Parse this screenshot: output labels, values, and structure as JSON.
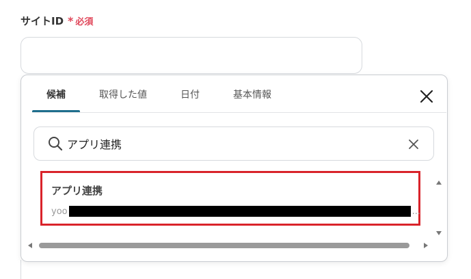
{
  "field": {
    "label": "サイトID",
    "required_star": "*",
    "required_text": "必須",
    "value": ""
  },
  "popover": {
    "tabs": [
      {
        "label": "候補",
        "active": true
      },
      {
        "label": "取得した値",
        "active": false
      },
      {
        "label": "日付",
        "active": false
      },
      {
        "label": "基本情報",
        "active": false
      }
    ],
    "close_icon": "close-icon",
    "search": {
      "value": "アプリ連携",
      "icon": "search-icon",
      "clear_icon": "clear-icon"
    },
    "results": [
      {
        "title": "アプリ連携",
        "subtitle_prefix": "yoo",
        "subtitle_suffix": "..."
      }
    ]
  },
  "colors": {
    "required": "#e0475a",
    "active_tab_indicator": "#1e6e8c",
    "highlight_border": "#d9232a"
  }
}
